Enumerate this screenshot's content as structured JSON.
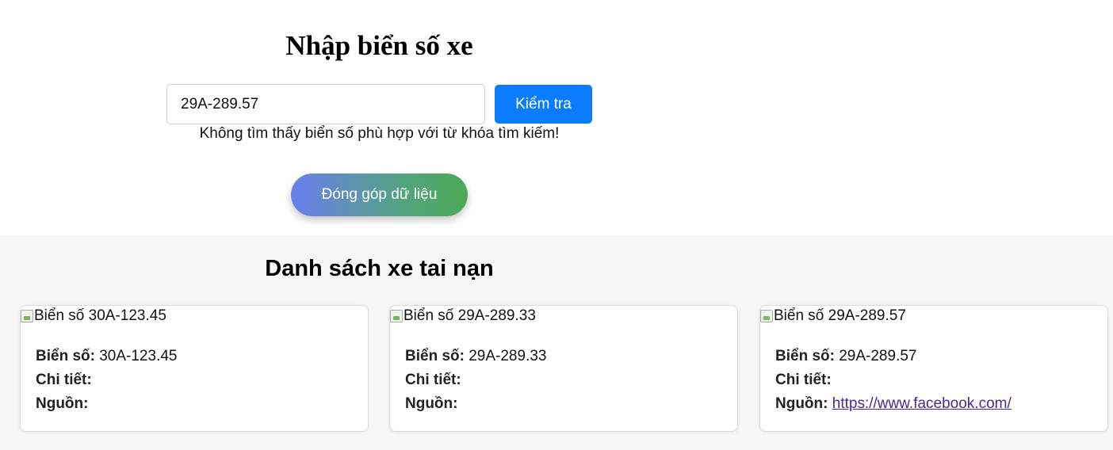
{
  "search": {
    "title": "Nhập biển số xe",
    "input_value": "29A-289.57",
    "button_label": "Kiểm tra",
    "no_result_message": "Không tìm thấy biển số phù hợp với từ khóa tìm kiếm!",
    "contribute_label": "Đóng góp dữ liệu"
  },
  "list": {
    "title": "Danh sách xe tai nạn",
    "labels": {
      "plate": "Biển số:",
      "detail": "Chi tiết:",
      "source": "Nguồn:"
    },
    "cards": [
      {
        "img_alt": "Biển số 30A-123.45",
        "plate": "30A-123.45",
        "detail": "",
        "source": ""
      },
      {
        "img_alt": "Biển số 29A-289.33",
        "plate": "29A-289.33",
        "detail": "",
        "source": ""
      },
      {
        "img_alt": "Biển số 29A-289.57",
        "plate": "29A-289.57",
        "detail": "",
        "source": "https://www.facebook.com/"
      }
    ]
  },
  "colors": {
    "primary_button": "#0a7cff",
    "gradient_start": "#6a7ff0",
    "gradient_end": "#4caa55",
    "link": "#4b2a8f",
    "section_background": "#f7f7f7"
  },
  "icons": {
    "card_image": "broken-image-icon"
  }
}
